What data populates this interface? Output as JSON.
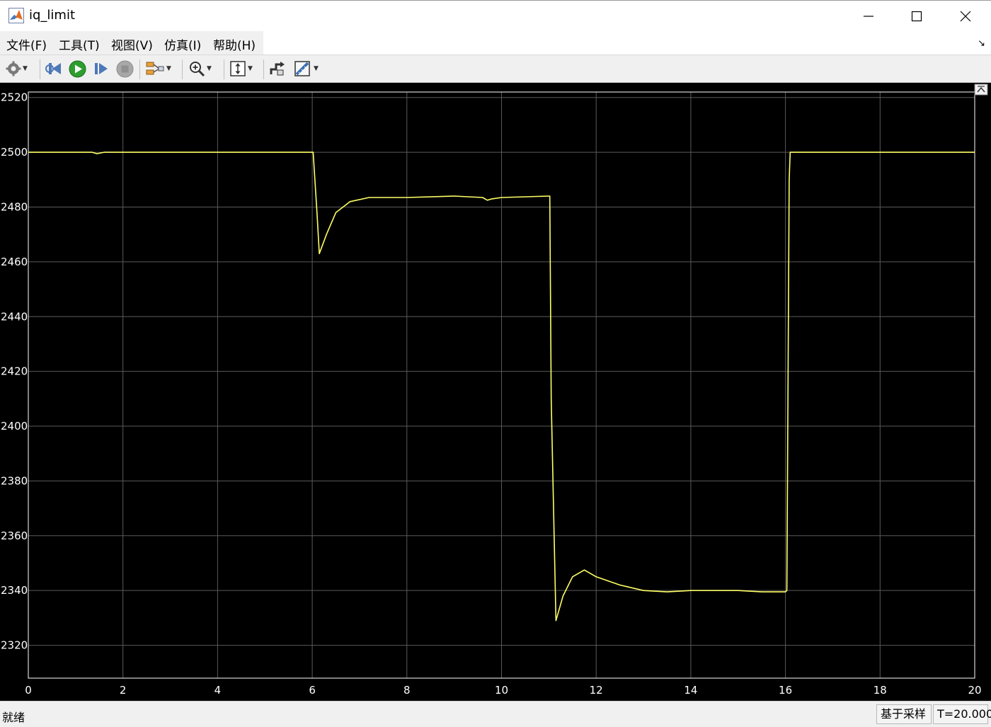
{
  "window": {
    "title": "iq_limit",
    "minimize_icon": "minimize-icon",
    "maximize_icon": "maximize-icon",
    "close_icon": "close-icon"
  },
  "menu": {
    "items": [
      {
        "label": "文件(F)"
      },
      {
        "label": "工具(T)"
      },
      {
        "label": "视图(V)"
      },
      {
        "label": "仿真(I)"
      },
      {
        "label": "帮助(H)"
      }
    ]
  },
  "toolbar": {
    "icons": [
      "gear-icon",
      "step-back-icon",
      "run-icon",
      "step-forward-icon",
      "stop-icon",
      "signal-selector-icon",
      "zoom-icon",
      "scale-axes-icon",
      "highlight-block-icon",
      "measurements-icon"
    ]
  },
  "colors": {
    "plot_bg": "#000000",
    "grid": "#5a5a5a",
    "axes": "#ffffff",
    "trace": "#ffff66",
    "tick_text": "#ffffff"
  },
  "chart_data": {
    "type": "line",
    "title": "",
    "xlabel": "",
    "ylabel": "",
    "xlim": [
      0,
      20
    ],
    "ylim": [
      2308,
      2522
    ],
    "x_ticks": [
      0,
      2,
      4,
      6,
      8,
      10,
      12,
      14,
      16,
      18,
      20
    ],
    "y_ticks": [
      2320,
      2340,
      2360,
      2380,
      2400,
      2420,
      2440,
      2460,
      2480,
      2500,
      2520
    ],
    "grid": true,
    "series": [
      {
        "name": "",
        "x": [
          0,
          1.35,
          1.45,
          1.6,
          6.0,
          6.02,
          6.1,
          6.15,
          6.3,
          6.5,
          6.8,
          7.2,
          8.0,
          9.0,
          9.6,
          9.7,
          9.8,
          10.0,
          11.0,
          11.02,
          11.05,
          11.15,
          11.3,
          11.5,
          11.75,
          12.0,
          12.5,
          13.0,
          13.5,
          14.0,
          14.5,
          15.0,
          15.5,
          16.0,
          16.03,
          16.08,
          16.1,
          17.0,
          18.0,
          19.0,
          20.0
        ],
        "y": [
          2500,
          2500,
          2499.5,
          2500,
          2500,
          2500,
          2478,
          2463,
          2470,
          2478,
          2482,
          2483.5,
          2483.5,
          2484,
          2483.5,
          2482.5,
          2483,
          2483.5,
          2484,
          2484,
          2410,
          2329,
          2338,
          2345,
          2347.5,
          2345,
          2342,
          2340,
          2339.5,
          2340,
          2340,
          2340,
          2339.5,
          2339.5,
          2340,
          2490,
          2500,
          2500,
          2500,
          2500,
          2500
        ]
      }
    ]
  },
  "status": {
    "left": "就绪",
    "mode": "基于采样",
    "time": "T=20.000"
  }
}
